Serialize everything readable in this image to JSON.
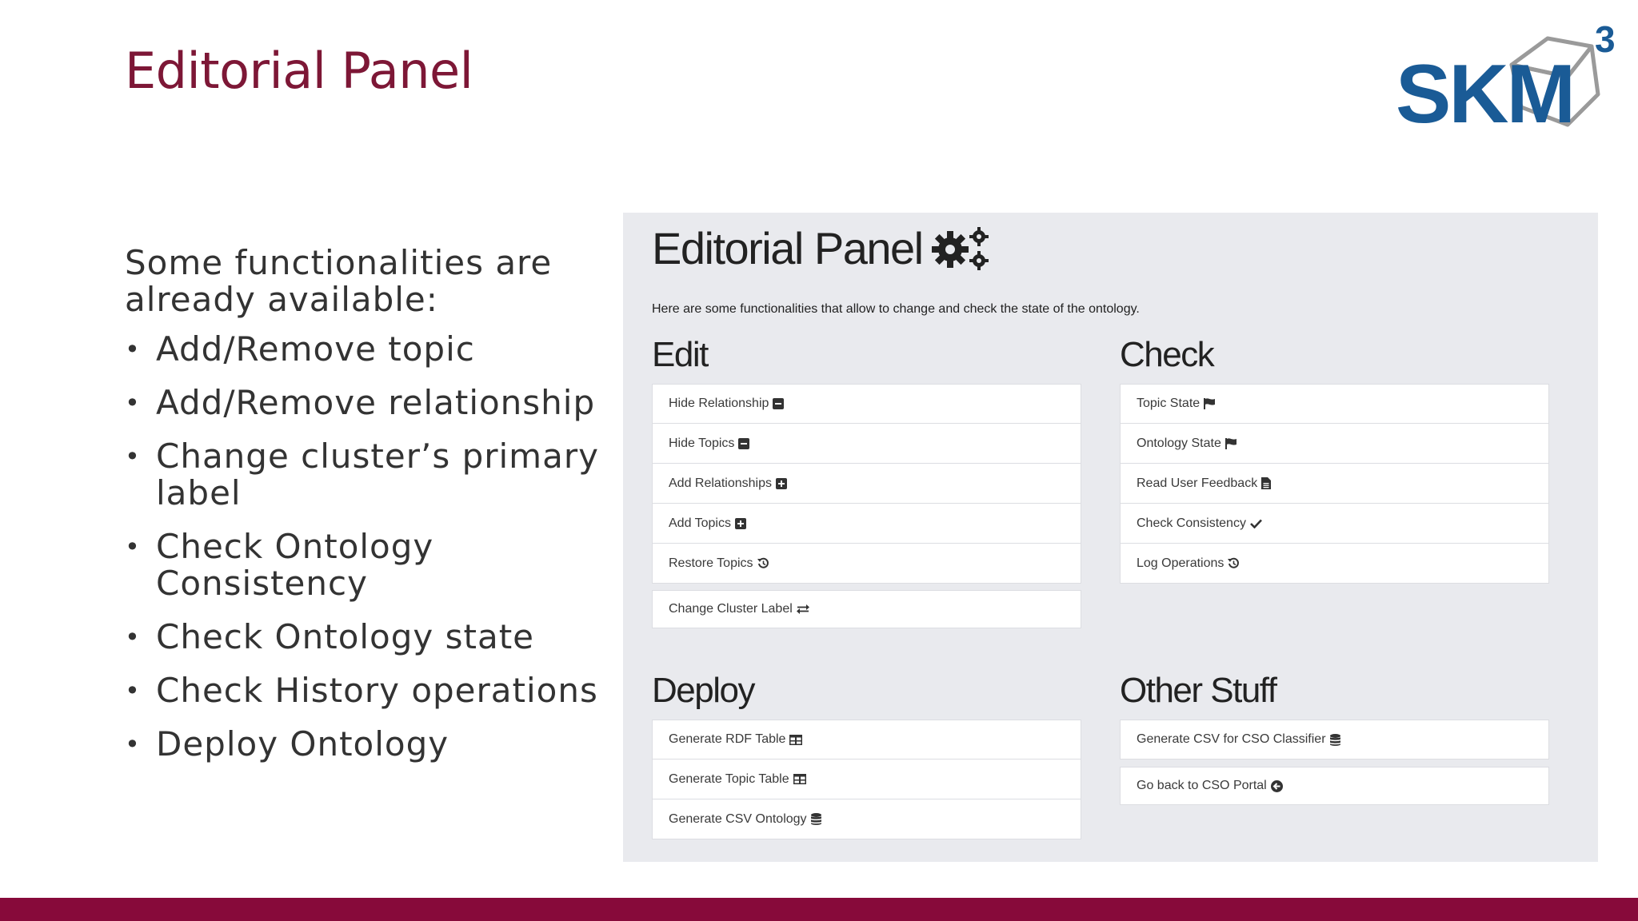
{
  "slide": {
    "title": "Editorial Panel",
    "logo_text": "SKM",
    "logo_sup": "3",
    "intro": "Some functionalities are already available:",
    "bullets": [
      "Add/Remove topic",
      "Add/Remove relationship",
      "Change cluster’s primary label",
      "Check Ontology Consistency",
      "Check Ontology state",
      "Check History operations",
      "Deploy Ontology"
    ],
    "bullet_char": "•"
  },
  "panel": {
    "title": "Editorial Panel",
    "title_icon": "gears-icon",
    "subtitle": "Here are some functionalities that allow to change and check the state of the ontology.",
    "edit": {
      "heading": "Edit",
      "items": [
        {
          "label": "Hide Relationship",
          "icon": "minus-square-icon"
        },
        {
          "label": "Hide Topics",
          "icon": "minus-square-icon"
        },
        {
          "label": "Add Relationships",
          "icon": "plus-square-icon"
        },
        {
          "label": "Add Topics",
          "icon": "plus-square-icon"
        },
        {
          "label": "Restore Topics",
          "icon": "history-icon"
        }
      ],
      "extra": {
        "label": "Change Cluster Label",
        "icon": "exchange-icon"
      }
    },
    "check": {
      "heading": "Check",
      "items": [
        {
          "label": "Topic State",
          "icon": "flag-icon"
        },
        {
          "label": "Ontology State",
          "icon": "flag-icon"
        },
        {
          "label": "Read User Feedback",
          "icon": "file-icon"
        },
        {
          "label": "Check Consistency",
          "icon": "check-icon"
        },
        {
          "label": "Log Operations",
          "icon": "history-icon"
        }
      ]
    },
    "deploy": {
      "heading": "Deploy",
      "items": [
        {
          "label": "Generate RDF Table",
          "icon": "table-icon"
        },
        {
          "label": "Generate Topic Table",
          "icon": "table-icon"
        },
        {
          "label": "Generate CSV Ontology",
          "icon": "database-icon"
        }
      ]
    },
    "other": {
      "heading": "Other Stuff",
      "items": [
        {
          "label": "Generate CSV for CSO Classifier",
          "icon": "database-icon"
        }
      ],
      "extra": {
        "label": "Go back to CSO Portal",
        "icon": "arrow-circle-left-icon"
      }
    }
  },
  "colors": {
    "title": "#7d1736",
    "footer": "#870a3a",
    "logo_blue": "#1a5b96",
    "panel_bg": "#e9eaee"
  }
}
